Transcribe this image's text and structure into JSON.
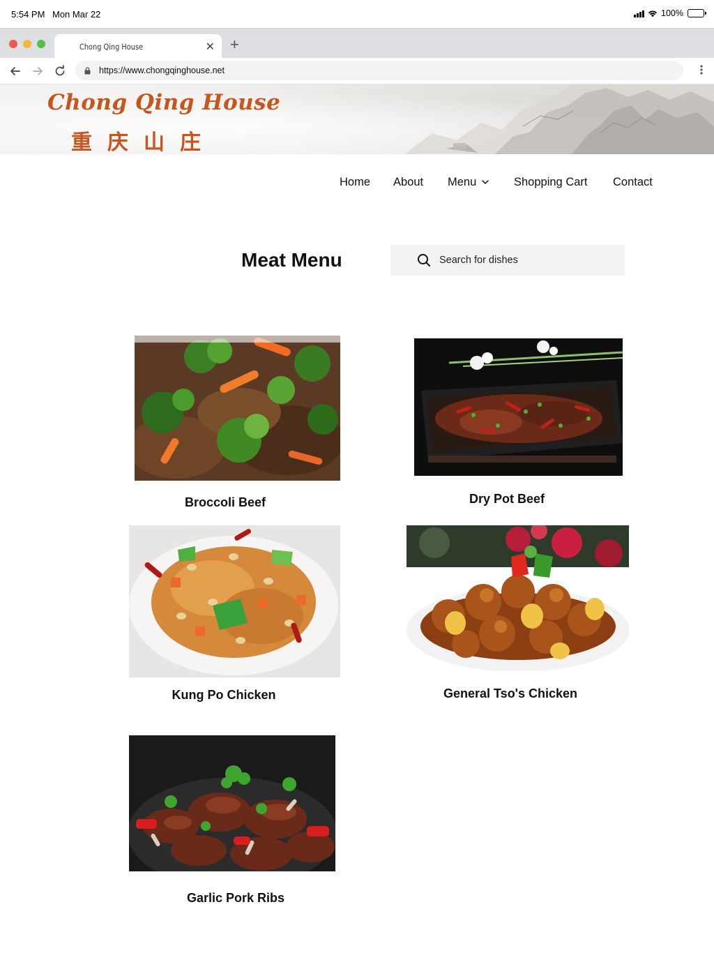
{
  "status_bar": {
    "time": "5:54 PM",
    "date": "Mon Mar 22",
    "battery": "100%"
  },
  "browser": {
    "tab_title": "Chong Qing House",
    "url": "https://www.chongqinghouse.net",
    "traffic_lights": [
      "#ee5b52",
      "#f4b73a",
      "#54c043"
    ]
  },
  "site": {
    "logo_en": "Chong Qing House",
    "logo_zh": "重庆山庄",
    "brand_color": "#c8551e"
  },
  "nav": {
    "home": "Home",
    "about": "About",
    "menu": "Menu",
    "cart": "Shopping Cart",
    "contact": "Contact"
  },
  "main": {
    "title": "Meat Menu",
    "search_placeholder": "Search for dishes"
  },
  "dishes": [
    {
      "name": "Broccoli Beef"
    },
    {
      "name": "Dry Pot Beef"
    },
    {
      "name": "Kung Po Chicken"
    },
    {
      "name": "General Tso's Chicken"
    },
    {
      "name": "Garlic Pork Ribs"
    }
  ]
}
